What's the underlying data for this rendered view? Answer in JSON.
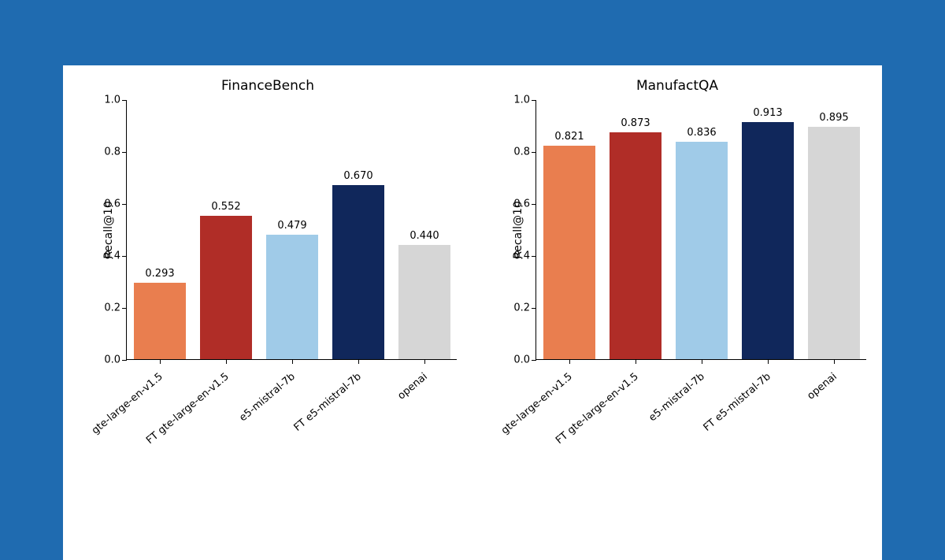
{
  "chart_data": [
    {
      "type": "bar",
      "title": "FinanceBench",
      "ylabel": "Recall@10",
      "xlabel": "",
      "ylim": [
        0.0,
        1.0
      ],
      "yticks": [
        0.0,
        0.2,
        0.4,
        0.6,
        0.8,
        1.0
      ],
      "categories": [
        "gte-large-en-v1.5",
        "FT gte-large-en-v1.5",
        "e5-mistral-7b",
        "FT e5-mistral-7b",
        "openai"
      ],
      "values": [
        0.293,
        0.552,
        0.479,
        0.67,
        0.44
      ],
      "value_labels": [
        "0.293",
        "0.552",
        "0.479",
        "0.670",
        "0.440"
      ],
      "colors": [
        "#e97e4f",
        "#b02d27",
        "#a0cbe8",
        "#10275b",
        "#d6d6d6"
      ]
    },
    {
      "type": "bar",
      "title": "ManufactQA",
      "ylabel": "Recall@10",
      "xlabel": "",
      "ylim": [
        0.0,
        1.0
      ],
      "yticks": [
        0.0,
        0.2,
        0.4,
        0.6,
        0.8,
        1.0
      ],
      "categories": [
        "gte-large-en-v1.5",
        "FT gte-large-en-v1.5",
        "e5-mistral-7b",
        "FT e5-mistral-7b",
        "openai"
      ],
      "values": [
        0.821,
        0.873,
        0.836,
        0.913,
        0.895
      ],
      "value_labels": [
        "0.821",
        "0.873",
        "0.836",
        "0.913",
        "0.895"
      ],
      "colors": [
        "#e97e4f",
        "#b02d27",
        "#a0cbe8",
        "#10275b",
        "#d6d6d6"
      ]
    }
  ],
  "ytick_labels": [
    "0.0",
    "0.2",
    "0.4",
    "0.6",
    "0.8",
    "1.0"
  ]
}
